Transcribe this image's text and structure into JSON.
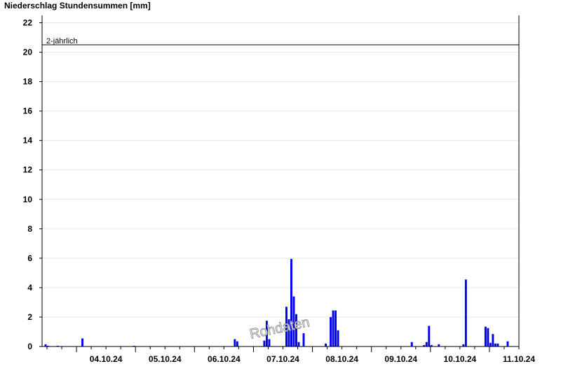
{
  "chart_data": {
    "type": "bar",
    "title": "Niederschlag Stundensummen [mm]",
    "xlabel": "",
    "ylabel": "",
    "ylim": [
      0,
      22.5
    ],
    "yticks": [
      0,
      2,
      4,
      6,
      8,
      10,
      12,
      14,
      16,
      18,
      20,
      22
    ],
    "x_start": "03.10.24 10:00",
    "x_end": "11.10.24 12:00",
    "x_tick_labels": [
      "04.10.24",
      "05.10.24",
      "06.10.24",
      "07.10.24",
      "08.10.24",
      "09.10.24",
      "10.10.24",
      "11.10.24"
    ],
    "grid": true,
    "bar_color": "#0000ee",
    "reference_line": {
      "label": "2-jährlich",
      "value": 20.5
    },
    "watermark": "Rohdaten",
    "bars": [
      {
        "t": "03.10.24 11:00",
        "v": 0.15
      },
      {
        "t": "03.10.24 12:00",
        "v": 0.05
      },
      {
        "t": "03.10.24 16:00",
        "v": 0.05
      },
      {
        "t": "04.10.24 02:00",
        "v": 0.55
      },
      {
        "t": "04.10.24 23:00",
        "v": 0.05
      },
      {
        "t": "06.10.24 16:00",
        "v": 0.5
      },
      {
        "t": "06.10.24 17:00",
        "v": 0.35
      },
      {
        "t": "07.10.24 04:00",
        "v": 0.4
      },
      {
        "t": "07.10.24 05:00",
        "v": 1.75
      },
      {
        "t": "07.10.24 06:00",
        "v": 0.5
      },
      {
        "t": "07.10.24 13:00",
        "v": 2.7
      },
      {
        "t": "07.10.24 14:00",
        "v": 1.85
      },
      {
        "t": "07.10.24 15:00",
        "v": 5.95
      },
      {
        "t": "07.10.24 16:00",
        "v": 3.4
      },
      {
        "t": "07.10.24 17:00",
        "v": 2.2
      },
      {
        "t": "07.10.24 18:00",
        "v": 0.3
      },
      {
        "t": "07.10.24 20:00",
        "v": 0.9
      },
      {
        "t": "08.10.24 05:00",
        "v": 0.2
      },
      {
        "t": "08.10.24 07:00",
        "v": 2.0
      },
      {
        "t": "08.10.24 08:00",
        "v": 2.45
      },
      {
        "t": "08.10.24 09:00",
        "v": 2.45
      },
      {
        "t": "08.10.24 10:00",
        "v": 1.1
      },
      {
        "t": "09.10.24 16:00",
        "v": 0.3
      },
      {
        "t": "09.10.24 21:00",
        "v": 0.1
      },
      {
        "t": "09.10.24 22:00",
        "v": 0.3
      },
      {
        "t": "09.10.24 23:00",
        "v": 1.4
      },
      {
        "t": "10.10.24 00:00",
        "v": 0.1
      },
      {
        "t": "10.10.24 03:00",
        "v": 0.15
      },
      {
        "t": "10.10.24 13:00",
        "v": 0.15
      },
      {
        "t": "10.10.24 14:00",
        "v": 4.55
      },
      {
        "t": "10.10.24 22:00",
        "v": 1.35
      },
      {
        "t": "10.10.24 23:00",
        "v": 1.25
      },
      {
        "t": "11.10.24 00:00",
        "v": 0.25
      },
      {
        "t": "11.10.24 01:00",
        "v": 0.85
      },
      {
        "t": "11.10.24 02:00",
        "v": 0.2
      },
      {
        "t": "11.10.24 03:00",
        "v": 0.2
      },
      {
        "t": "11.10.24 07:00",
        "v": 0.35
      }
    ]
  }
}
